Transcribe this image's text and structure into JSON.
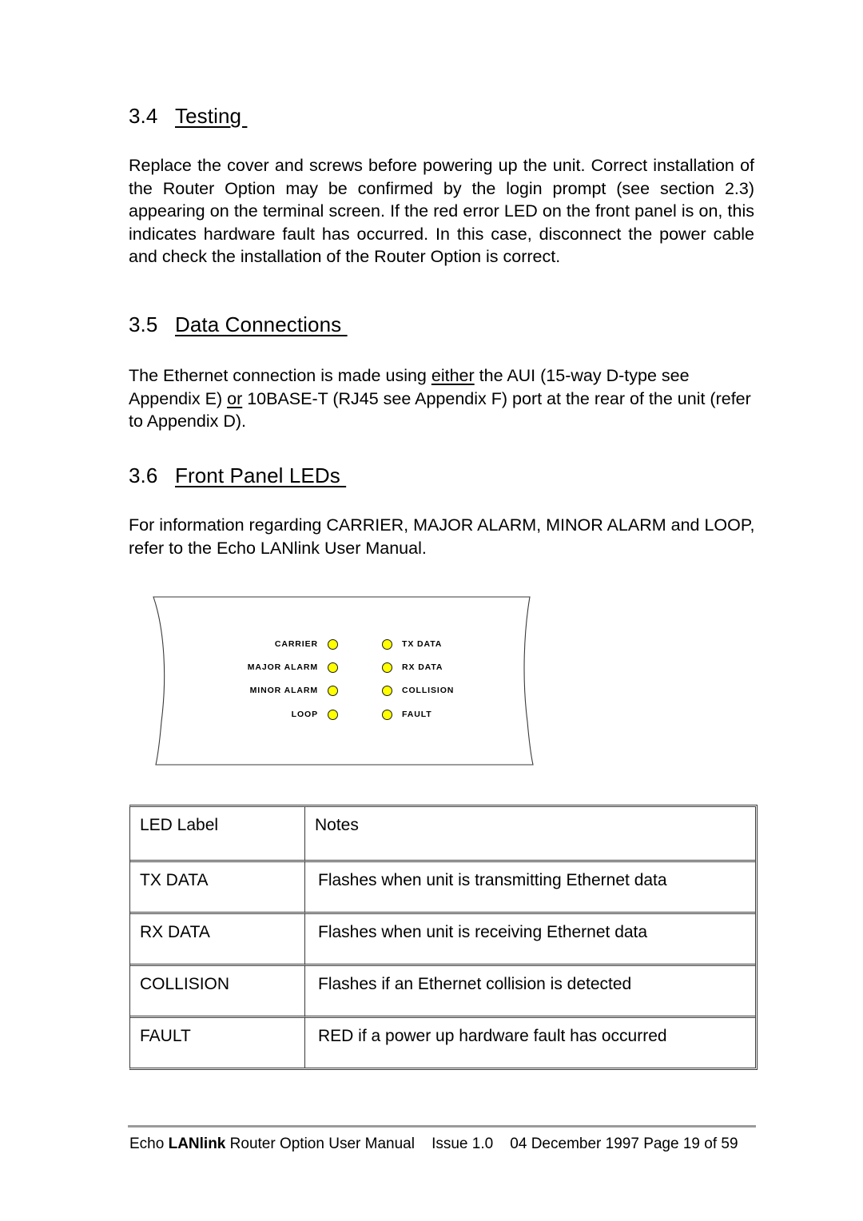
{
  "document": {
    "sections": [
      {
        "number": "3.4",
        "title": "Testing ",
        "paragraph": "Replace the cover and screws before powering up the unit. Correct installation of the Router Option may be confirmed by the login prompt (see section 2.3) appearing on the terminal screen. If the red error LED on the front panel is on, this indicates hardware fault has occurred. In this case, disconnect the power cable and check the installation of the Router Option is correct."
      },
      {
        "number": "3.5",
        "title": "Data Connections ",
        "paragraph_parts": {
          "p1": "The Ethernet connection is made using ",
          "u1": "either",
          "p2": " the AUI (15-way D-type   see Appendix E) ",
          "u2": "or",
          "p3": " 10BASE-T (RJ45 see Appendix F) port at the rear of the unit (refer to Appendix D)."
        }
      },
      {
        "number": "3.6",
        "title": "Front Panel LEDs ",
        "paragraph": "For information regarding CARRIER, MAJOR ALARM, MINOR ALARM and LOOP, refer to the Echo LANlink User Manual."
      }
    ]
  },
  "front_panel": {
    "led_color": "#FFFF00",
    "outline_color": "#3a3a3a",
    "rows": [
      {
        "left_label": "CARRIER",
        "right_label": "TX  DATA"
      },
      {
        "left_label": "MAJOR  ALARM",
        "right_label": "RX  DATA"
      },
      {
        "left_label": "MINOR  ALARM",
        "right_label": "COLLISION"
      },
      {
        "left_label": "LOOP",
        "right_label": "FAULT"
      }
    ]
  },
  "led_table": {
    "headers": [
      "LED Label",
      "Notes"
    ],
    "rows": [
      [
        "TX DATA",
        "Flashes when unit is transmitting Ethernet data"
      ],
      [
        "RX DATA",
        "Flashes when unit is receiving Ethernet data"
      ],
      [
        "COLLISION",
        "Flashes if an Ethernet collision is detected"
      ],
      [
        "FAULT",
        "RED if a power up hardware fault has occurred"
      ]
    ]
  },
  "footer": {
    "manual_prefix": "Echo ",
    "manual_brand": "LANlink",
    "manual_suffix": " Router Option User Manual",
    "issue": "Issue 1.0",
    "date": "04 December 1997",
    "page": "Page 19 of 59"
  }
}
